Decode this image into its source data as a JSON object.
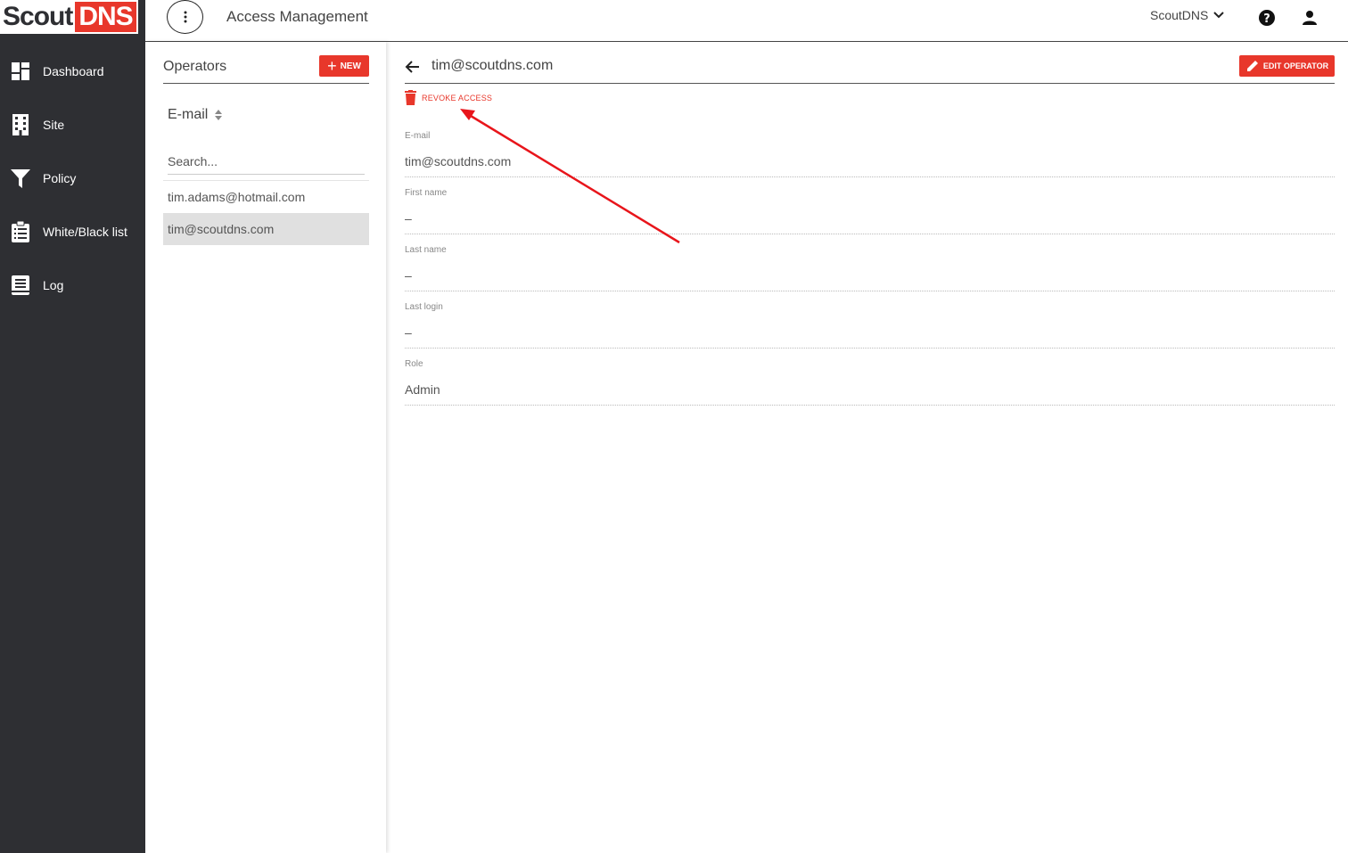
{
  "brand": {
    "logo_left": "Scout",
    "logo_right": "DNS"
  },
  "sidebar": {
    "items": [
      {
        "label": "Dashboard",
        "icon": "dashboard-icon"
      },
      {
        "label": "Site",
        "icon": "building-icon"
      },
      {
        "label": "Policy",
        "icon": "filter-icon"
      },
      {
        "label": "White/Black list",
        "icon": "clipboard-list-icon"
      },
      {
        "label": "Log",
        "icon": "book-icon"
      }
    ]
  },
  "header": {
    "title": "Access Management",
    "org_selector": "ScoutDNS",
    "help_icon": "help-icon",
    "user_icon": "user-icon"
  },
  "operators": {
    "title": "Operators",
    "new_label": "NEW",
    "sort_column": "E-mail",
    "search_placeholder": "Search...",
    "items": [
      {
        "email": "tim.adams@hotmail.com",
        "selected": false
      },
      {
        "email": "tim@scoutdns.com",
        "selected": true
      }
    ]
  },
  "detail": {
    "title": "tim@scoutdns.com",
    "edit_label": "EDIT OPERATOR",
    "revoke_label": "REVOKE ACCESS",
    "fields": [
      {
        "label": "E-mail",
        "value": "tim@scoutdns.com"
      },
      {
        "label": "First name",
        "value": "–"
      },
      {
        "label": "Last name",
        "value": "–"
      },
      {
        "label": "Last login",
        "value": "–"
      },
      {
        "label": "Role",
        "value": "Admin"
      }
    ]
  },
  "colors": {
    "accent": "#e8372b",
    "sidebar_bg": "#2e2f33",
    "annotation": "#e8151b"
  }
}
